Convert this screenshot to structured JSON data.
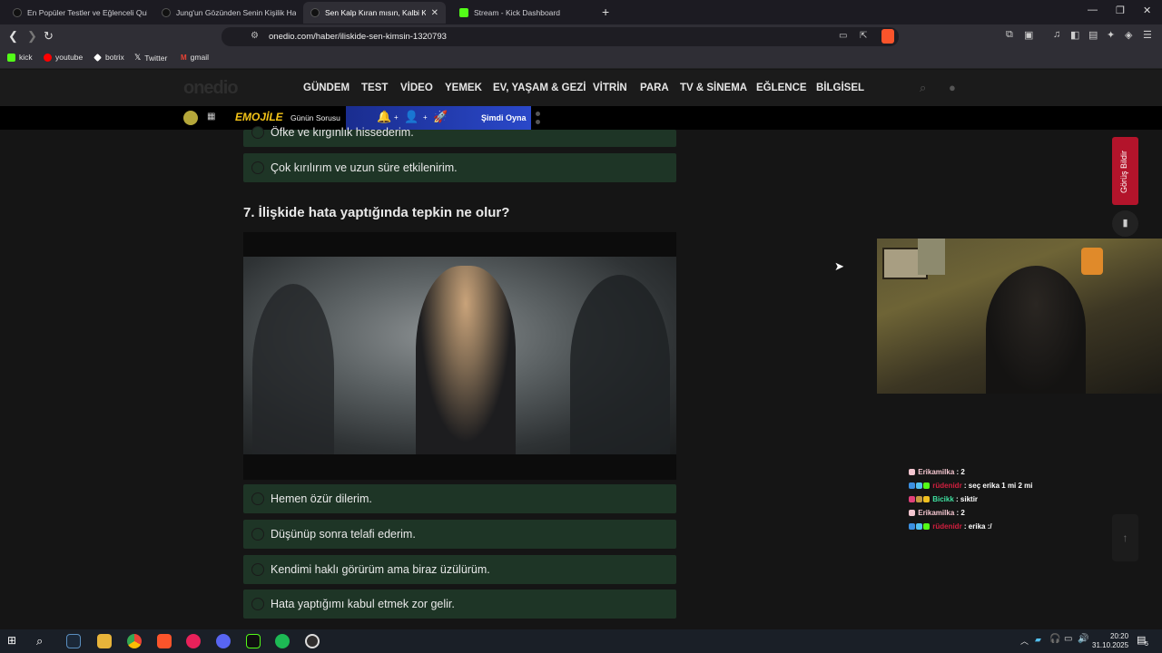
{
  "browser": {
    "tabs": [
      {
        "label": "En Popüler Testler ve Eğlenceli Quizler",
        "active": false
      },
      {
        "label": "Jung'un Gözünden Senin Kişilik Haritan",
        "active": false
      },
      {
        "label": "Sen Kalp Kıran mısın, Kalbi Kırılan mı?",
        "active": true
      },
      {
        "label": "Stream - Kick Dashboard",
        "active": false
      }
    ],
    "url": "onedio.com/haber/iliskide-sen-kimsin-1320793",
    "bookmarks": [
      {
        "label": "kick",
        "color": "#53fc18"
      },
      {
        "label": "youtube",
        "color": "#ff0000"
      },
      {
        "label": "botrix",
        "color": "#ffffff"
      },
      {
        "label": "Twitter",
        "color": "#ffffff"
      },
      {
        "label": "gmail",
        "color": "#ea4335"
      }
    ]
  },
  "site": {
    "logo": "onedio",
    "menu": [
      "GÜNDEM",
      "TEST",
      "VİDEO",
      "YEMEK",
      "EV, YAŞAM & GEZİ",
      "VİTRİN",
      "PARA",
      "TV & SİNEMA",
      "EĞLENCE",
      "BİLGİSEL"
    ],
    "subbar": {
      "emojile": "EMOJİLE",
      "gunun_sorusu": "Günün Sorusu",
      "cta": "Şimdi Oyna"
    }
  },
  "quiz": {
    "prev_options": [
      "Öfke ve kırgınlık hissederim.",
      "Çok kırılırım ve uzun süre etkilenirim."
    ],
    "question": "7. İlişkide hata yaptığında tepkin ne olur?",
    "options": [
      "Hemen özür dilerim.",
      "Düşünüp sonra telafi ederim.",
      "Kendimi haklı görürüm ama biraz üzülürüm.",
      "Hata yaptığımı kabul etmek zor gelir."
    ]
  },
  "side": {
    "feedback": "Görüş Bildir"
  },
  "chat": [
    {
      "user": "Erikamilka",
      "msg": " : 2",
      "color": "#f4c6d0"
    },
    {
      "user": "rüdenidr",
      "msg": " : seç erika 1 mi 2 mi",
      "color": "#d31f3f"
    },
    {
      "user": "Bicikk",
      "msg": " : siktir",
      "color": "#3fe0a0"
    },
    {
      "user": "Erikamilka",
      "msg": " : 2",
      "color": "#f4c6d0"
    },
    {
      "user": "rüdenidr",
      "msg": " : erika :/",
      "color": "#d31f3f"
    }
  ],
  "taskbar": {
    "time": "20:20",
    "date": "31.10.2025",
    "notif_count": "5"
  }
}
